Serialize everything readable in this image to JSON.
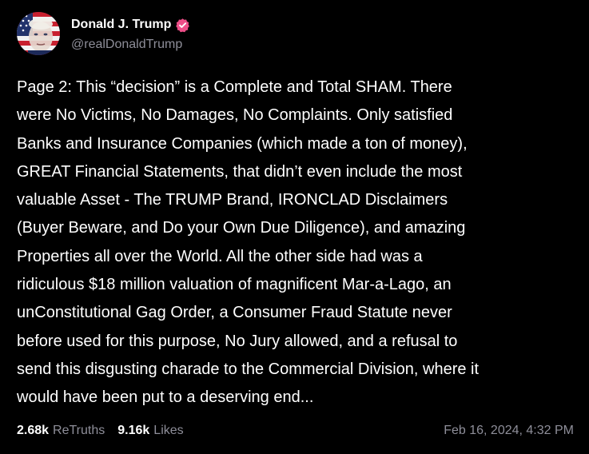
{
  "post": {
    "author": {
      "display_name": "Donald J. Trump",
      "handle": "@realDonaldTrump",
      "verified": true,
      "badge_color": "#ee4e88"
    },
    "body": "Page 2: This “decision” is a Complete and Total SHAM. There\nwere No Victims, No Damages, No Complaints. Only satisfied\nBanks and Insurance Companies (which made a ton of money),\nGREAT Financial Statements, that didn’t even include the most\nvaluable Asset - The TRUMP Brand, IRONCLAD Disclaimers\n(Buyer Beware, and Do your Own Due Diligence), and amazing\nProperties all over the World. All the other side had was a\nridiculous $18 million valuation of magnificent Mar-a-Lago, an\nunConstitutional Gag Order, a Consumer Fraud Statute never\nbefore used for this purpose, No Jury allowed, and a refusal to\nsend this disgusting charade to the Commercial Division, where it\nwould have been put to a deserving end...",
    "stats": {
      "retruths_count": "2.68k",
      "retruths_label": "ReTruths",
      "likes_count": "9.16k",
      "likes_label": "Likes"
    },
    "timestamp": "Feb 16, 2024, 4:32 PM"
  },
  "colors": {
    "background": "#000000",
    "text_primary": "#ffffff",
    "text_secondary": "#8e8e99",
    "verified_badge": "#ee4e88"
  }
}
